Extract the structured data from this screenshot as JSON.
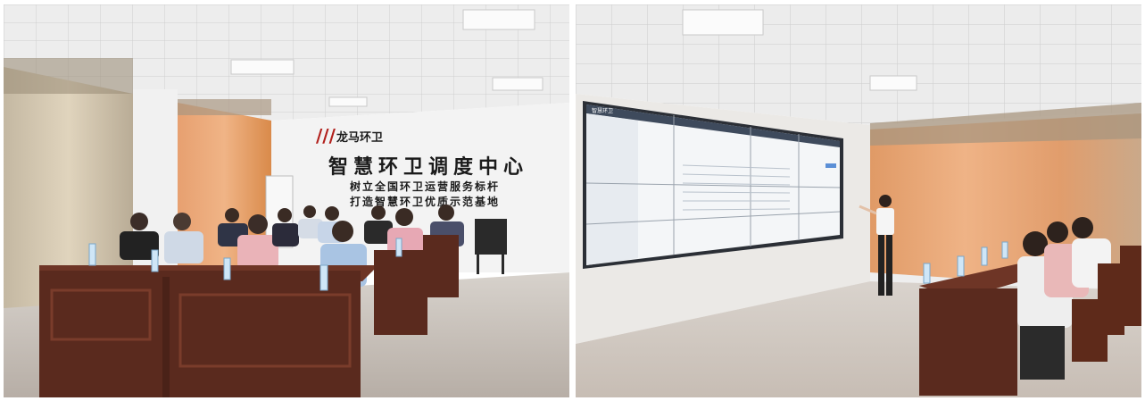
{
  "left_photo": {
    "wall_logo_text": "龙马环卫",
    "wall_title": "智慧环卫调度中心",
    "wall_line_1": "树立全国环卫运营服务标杆",
    "wall_line_2": "打造智慧环卫优质示范基地"
  },
  "right_photo": {
    "screen_title": "智慧环卫"
  },
  "colors": {
    "desk": "#5a2a1e",
    "curtain": "#d98a4a",
    "ceiling": "#eeeeee",
    "screen": "#f4f6f8"
  }
}
